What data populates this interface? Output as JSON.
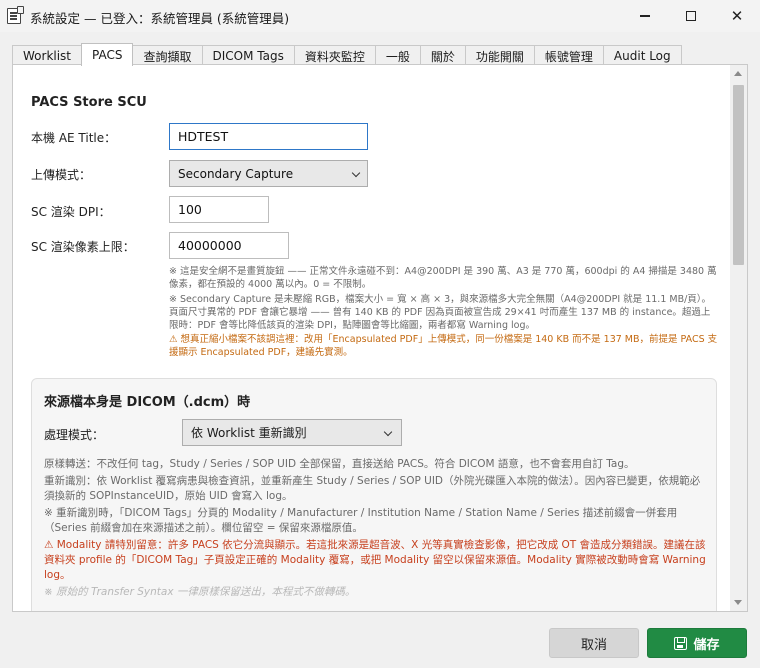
{
  "window": {
    "title": "系統設定 — 已登入：系統管理員 (系統管理員)",
    "minimize": "—",
    "close": "✕"
  },
  "tabs": [
    {
      "label": "Worklist"
    },
    {
      "label": "PACS"
    },
    {
      "label": "查詢擷取"
    },
    {
      "label": "DICOM Tags"
    },
    {
      "label": "資料夾監控"
    },
    {
      "label": "一般"
    },
    {
      "label": "關於"
    },
    {
      "label": "功能開關"
    },
    {
      "label": "帳號管理"
    },
    {
      "label": "Audit Log"
    }
  ],
  "active_tab": "PACS",
  "store_scu": {
    "section_title": "PACS Store SCU",
    "ae_title_label": "本機 AE Title：",
    "ae_title_value": "HDTEST",
    "upload_mode_label": "上傳模式：",
    "upload_mode_value": "Secondary Capture",
    "dpi_label": "SC 渲染 DPI：",
    "dpi_value": "100",
    "pixel_limit_label": "SC 渲染像素上限：",
    "pixel_limit_value": "40000000",
    "note1": "※ 這是安全網不是畫質旋鈕 —— 正常文件永遠碰不到：A4@200DPI 是 390 萬、A3 是 770 萬，600dpi 的 A4 掃描是 3480 萬像素，都在預設的 4000 萬以內。0 = 不限制。",
    "note2": "※ Secondary Capture 是未壓縮 RGB，檔案大小 = 寬 × 高 × 3，與來源檔多大完全無關（A4@200DPI 就是 11.1 MB/頁）。頁面尺寸異常的 PDF 會讓它暴增 —— 曾有 140 KB 的 PDF 因為頁面被宣告成 29×41 吋而產生 137 MB 的 instance。超過上限時：PDF 會等比降低該頁的渲染 DPI，點陣圖會等比縮圖，兩者都寫 Warning log。",
    "note3": "⚠ 想真正縮小檔案不該調這裡：改用「Encapsulated PDF」上傳模式，同一份檔案是 140 KB 而不是 137 MB，前提是 PACS 支援顯示 Encapsulated PDF，建議先實測。"
  },
  "dicom_source": {
    "title": "來源檔本身是 DICOM（.dcm）時",
    "mode_label": "處理模式：",
    "mode_value": "依 Worklist 重新識別",
    "note1": "原樣轉送：不改任何 tag，Study / Series / SOP UID 全部保留，直接送給 PACS。符合 DICOM 語意，也不會套用自訂 Tag。",
    "note2": "重新識別：依 Worklist 覆寫病患與檢查資訊，並重新產生 Study / Series / SOP UID（外院光碟匯入本院的做法）。因內容已變更，依規範必須換新的 SOPInstanceUID，原始 UID 會寫入 log。",
    "note3": "※ 重新識別時，「DICOM Tags」分頁的 Modality / Manufacturer / Institution Name / Station Name / Series 描述前綴會一併套用（Series 前綴會加在來源描述之前）。欄位留空 = 保留來源檔原值。",
    "note4": "⚠ Modality 請特別留意：許多 PACS 依它分流與顯示。若這批來源是超音波、X 光等真實檢查影像，把它改成 OT 會造成分類錯誤。建議在該資料夾 profile 的「DICOM Tag」子頁設定正確的 Modality 覆寫，或把 Modality 留空以保留來源值。Modality 實際被改動時會寫 Warning log。",
    "note5": "※ 原始的 Transfer Syntax 一律原樣保留送出，本程式不做轉碼。"
  },
  "footer": {
    "cancel_label": "取消",
    "save_label": "儲存"
  },
  "colors": {
    "save_button": "#218b44",
    "focus_border": "#2e77c8",
    "warning_text": "#c7401e",
    "hint_warning_text": "#c46a12"
  }
}
